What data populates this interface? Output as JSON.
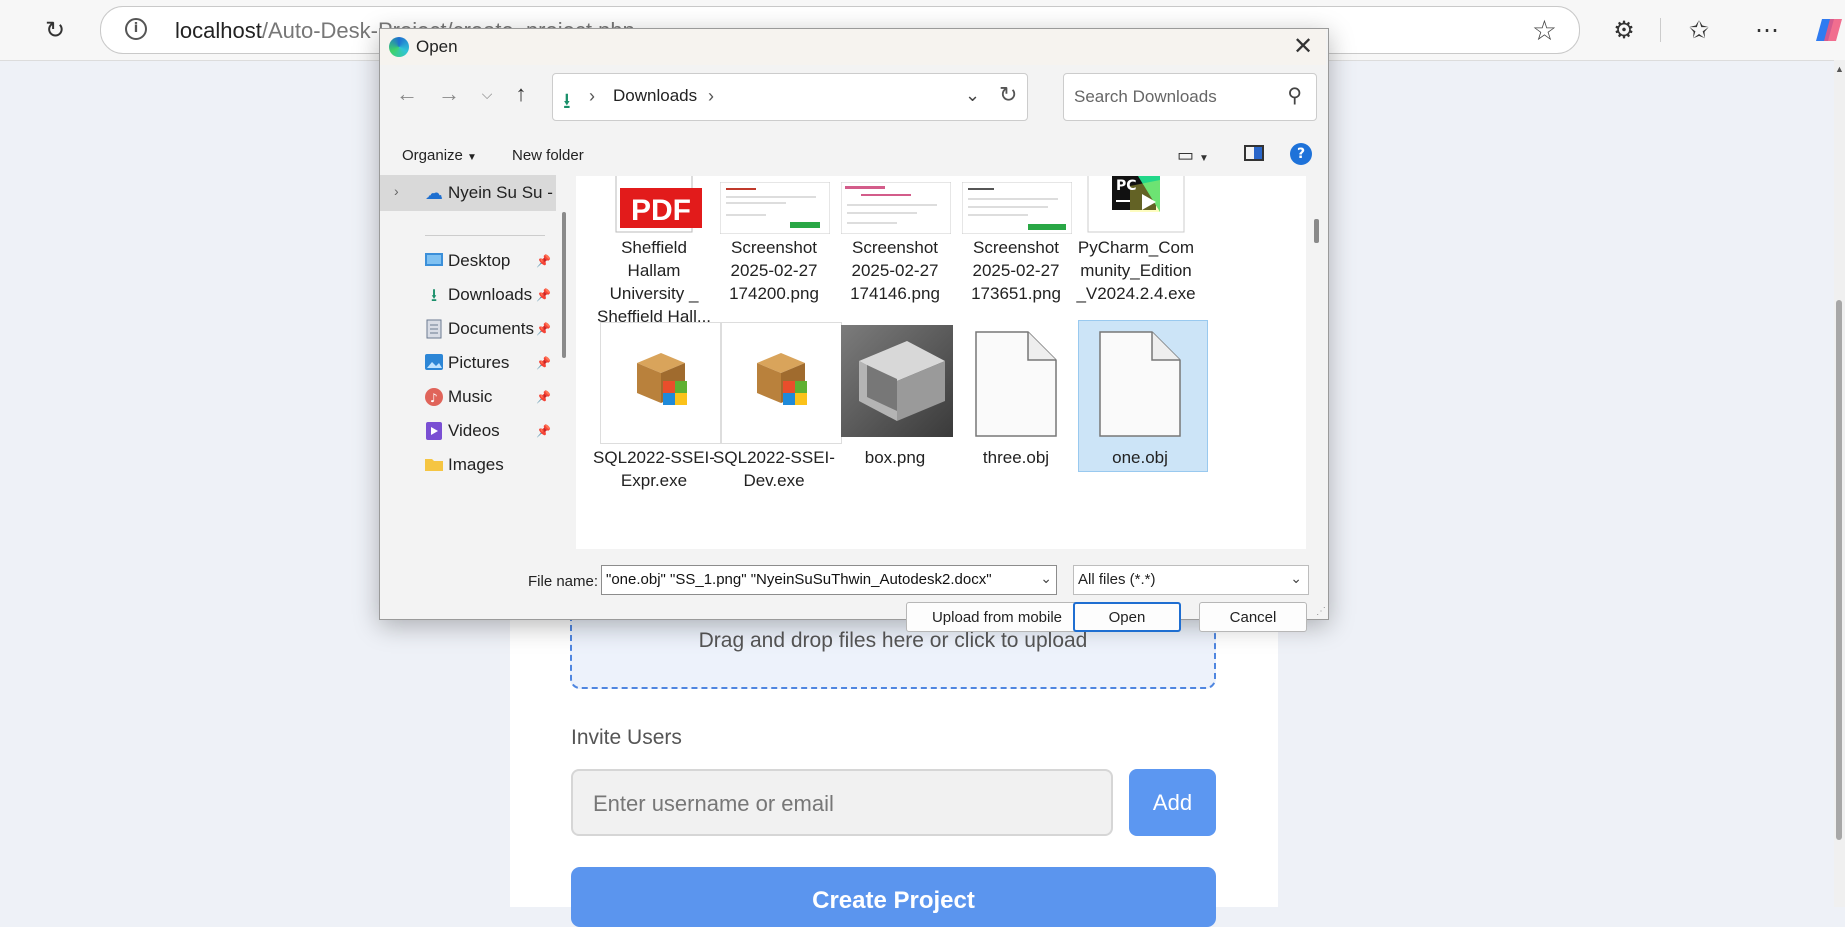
{
  "browser": {
    "url_host": "localhost",
    "url_path": "/Auto-Desk-Project/create_project.php"
  },
  "page": {
    "drop_text": "Drag and drop files here or click to upload",
    "invite_label": "Invite Users",
    "invite_placeholder": "Enter username or email",
    "add_label": "Add",
    "create_label": "Create Project"
  },
  "dialog": {
    "title": "Open",
    "path": [
      "Downloads"
    ],
    "search_placeholder": "Search Downloads",
    "organize_label": "Organize",
    "new_folder_label": "New folder",
    "sidebar": [
      {
        "label": "Nyein Su Su -",
        "icon": "onedrive-cloud-icon",
        "selected": true
      },
      {
        "label": "Desktop",
        "icon": "desktop-icon"
      },
      {
        "label": "Downloads",
        "icon": "download-icon"
      },
      {
        "label": "Documents",
        "icon": "documents-icon"
      },
      {
        "label": "Pictures",
        "icon": "pictures-icon"
      },
      {
        "label": "Music",
        "icon": "music-icon"
      },
      {
        "label": "Videos",
        "icon": "videos-icon"
      },
      {
        "label": "Images",
        "icon": "folder-icon"
      }
    ],
    "files": [
      {
        "lines": [
          "Sheffield",
          "Hallam",
          "University _",
          "Sheffield Hall..."
        ],
        "kind": "pdf-icon"
      },
      {
        "lines": [
          "Screenshot",
          "2025-02-27",
          "174200.png"
        ],
        "kind": "screenshot-thumbnail"
      },
      {
        "lines": [
          "Screenshot",
          "2025-02-27",
          "174146.png"
        ],
        "kind": "screenshot-thumbnail"
      },
      {
        "lines": [
          "Screenshot",
          "2025-02-27",
          "173651.png"
        ],
        "kind": "screenshot-thumbnail"
      },
      {
        "lines": [
          "PyCharm_Com",
          "munity_Edition",
          "_V2024.2.4.exe"
        ],
        "kind": "pycharm-icon"
      },
      {
        "lines": [
          "SQL2022-SSEI-",
          "Expr.exe"
        ],
        "kind": "installer-icon"
      },
      {
        "lines": [
          "SQL2022-SSEI-",
          "Dev.exe"
        ],
        "kind": "installer-icon"
      },
      {
        "lines": [
          "box.png"
        ],
        "kind": "box-image-thumbnail"
      },
      {
        "lines": [
          "three.obj"
        ],
        "kind": "blank-file-icon"
      },
      {
        "lines": [
          "one.obj"
        ],
        "kind": "blank-file-icon",
        "selected": true
      }
    ],
    "file_name_label": "File name:",
    "file_name_value": "\"one.obj\" \"SS_1.png\" \"NyeinSuSuThwin_Autodesk2.docx\"",
    "file_type": "All files (*.*)",
    "upload_mobile_label": "Upload from mobile",
    "open_label": "Open",
    "cancel_label": "Cancel"
  }
}
